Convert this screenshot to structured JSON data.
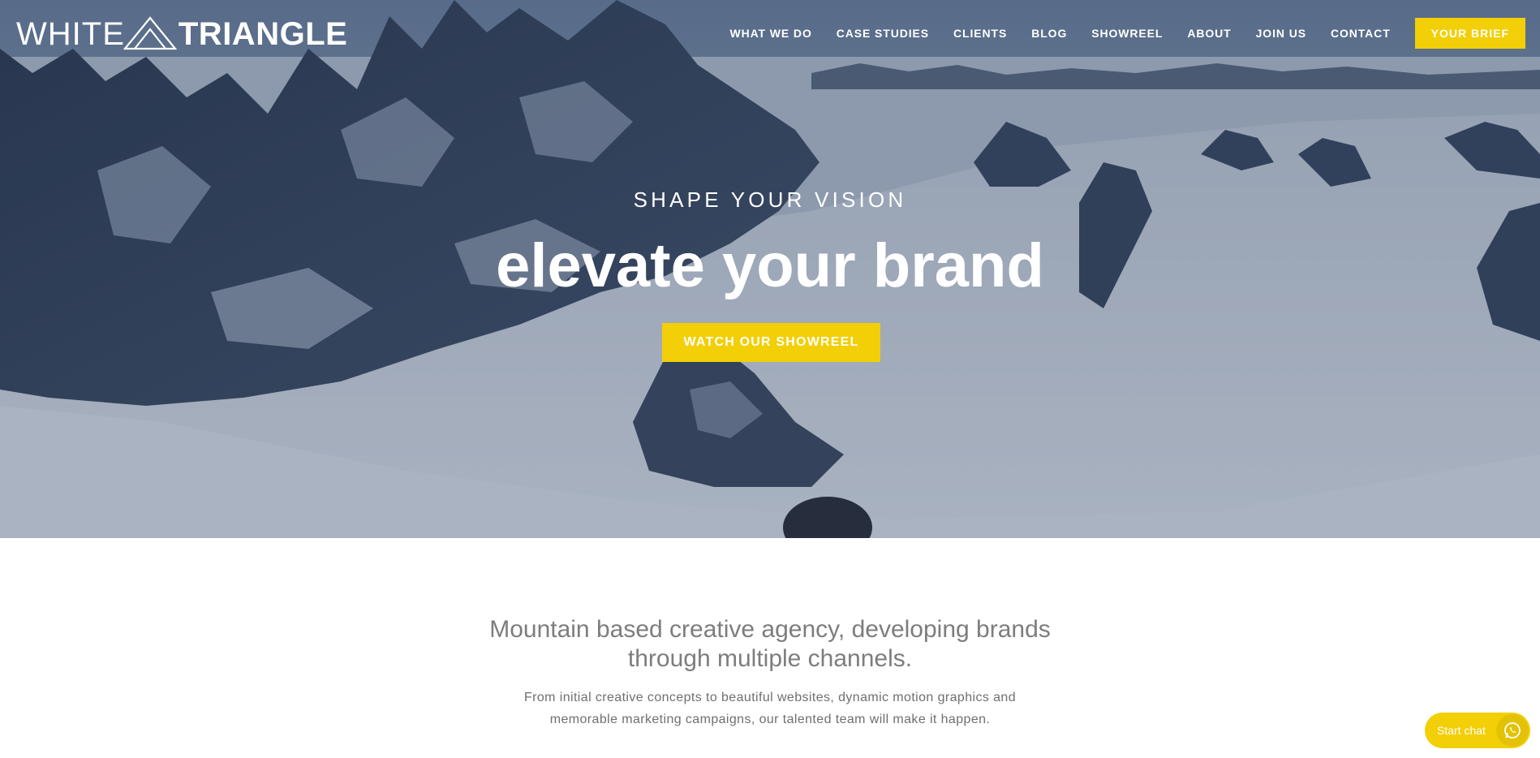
{
  "logo": {
    "part1": "WHITE",
    "part2": "TRIANGLE"
  },
  "nav": {
    "items": [
      {
        "label": "WHAT WE DO"
      },
      {
        "label": "CASE STUDIES"
      },
      {
        "label": "CLIENTS"
      },
      {
        "label": "BLOG"
      },
      {
        "label": "SHOWREEL"
      },
      {
        "label": "ABOUT"
      },
      {
        "label": "JOIN US"
      },
      {
        "label": "CONTACT"
      }
    ],
    "cta_label": "YOUR BRIEF"
  },
  "hero": {
    "kicker": "SHAPE YOUR VISION",
    "title": "elevate your brand",
    "cta_label": "WATCH OUR SHOWREEL"
  },
  "intro": {
    "heading": "Mountain based creative agency, developing brands through multiple channels.",
    "body": "From initial creative concepts to beautiful websites, dynamic motion graphics and memorable marketing campaigns, our talented team will make it happen."
  },
  "chat": {
    "label": "Start chat",
    "icon": "whatsapp-icon"
  },
  "colors": {
    "accent": "#f2cf06",
    "text_grey": "#7d7d7d",
    "white": "#ffffff"
  }
}
